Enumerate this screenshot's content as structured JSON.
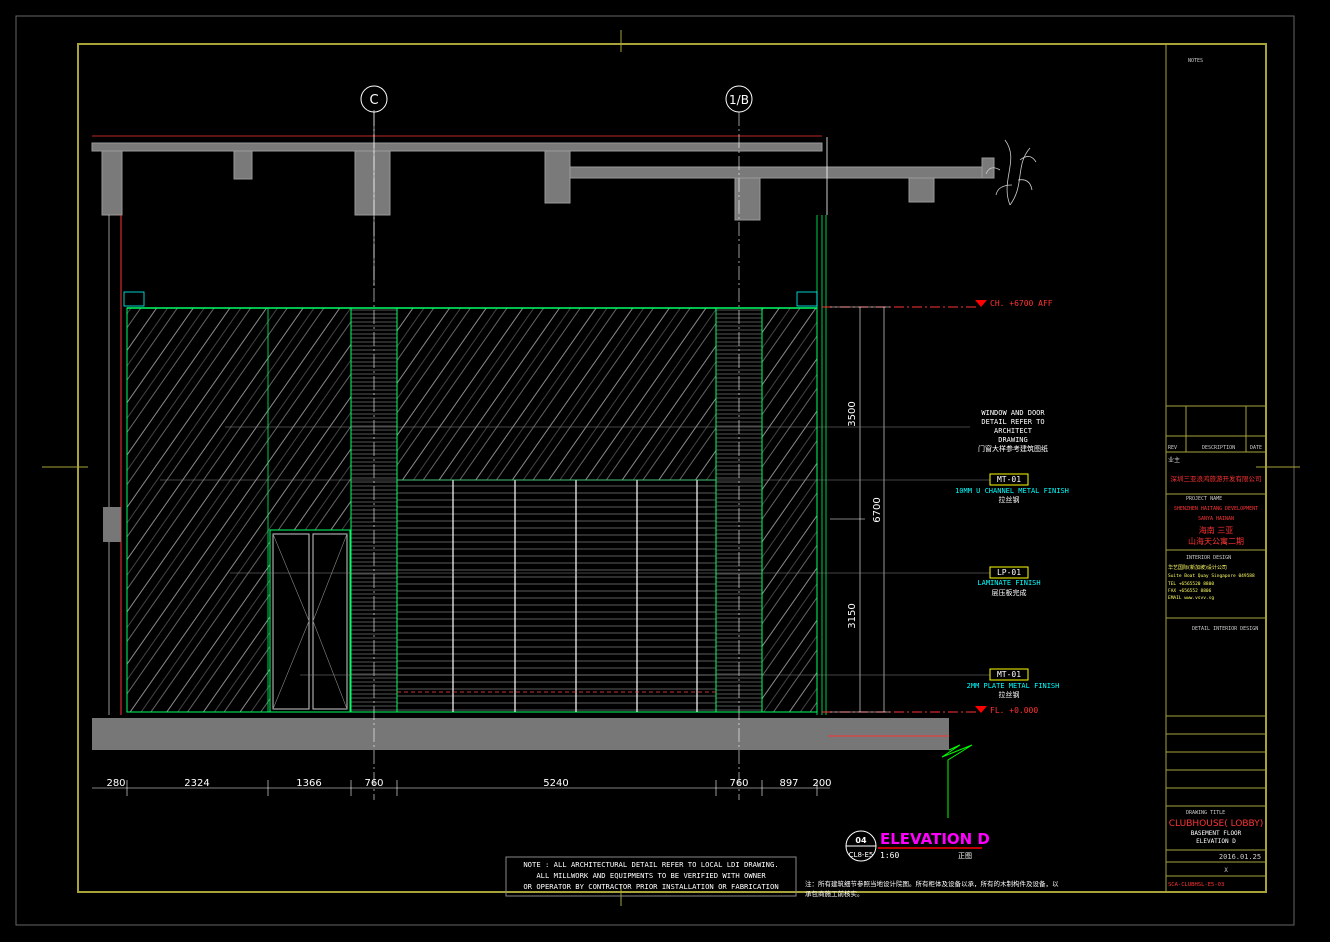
{
  "grid": {
    "left_label": "C",
    "right_label": "1/B"
  },
  "levels": {
    "ceiling": "CH. +6700 AFF",
    "floor": "FL. +0.000"
  },
  "vertical_dims": {
    "upper": "3500",
    "lower": "3150",
    "total": "6700"
  },
  "horizontal_dims": [
    "280",
    "2324",
    "1366",
    "760",
    "5240",
    "760",
    "897",
    "200"
  ],
  "callouts": {
    "window_note": [
      "WINDOW AND DOOR",
      "DETAIL REFER TO",
      "ARCHITECT",
      "DRAWING",
      "门窗大样参考建筑图纸"
    ],
    "mt1_tag": "MT-01",
    "mt1_desc": "10MM U CHANNEL METAL FINISH",
    "mt1_cn": "拉丝钢",
    "lp1_tag": "LP-01",
    "lp1_desc": "LAMINATE FINISH",
    "lp1_cn": "层压板完成",
    "mt1b_tag": "MT-01",
    "mt1b_desc": "2MM PLATE METAL FINISH",
    "mt1b_cn": "拉丝钢"
  },
  "title_mark": {
    "number": "04",
    "sheet": "CL8-E5",
    "title": "ELEVATION D",
    "scale": "1:60",
    "scale_note": "正图"
  },
  "notes": {
    "en": [
      "NOTE : ALL ARCHITECTURAL DETAIL REFER TO LOCAL LDI DRAWING.",
      "ALL MILLWORK AND EQUIPMENTS TO BE VERIFIED WITH OWNER",
      "OR OPERATOR BY CONTRACTOR PRIOR INSTALLATION OR FABRICATION"
    ],
    "cn": [
      "注：所有建筑细节参照当地设计院图。所有柜体及设备以承，所有的木制构件及设备，以",
      "承包商施工前核实。"
    ]
  },
  "title_block": {
    "notes_header": "NOTES",
    "rev_header": [
      "REV",
      "DESCRIPTION",
      "DATE"
    ],
    "owner_label": "业主",
    "owner_name": "深圳三亚浪鸿旅游开发有限公司",
    "project_label": "PROJECT NAME",
    "project_en": "SHENZHEN HAITANG DEVELOPMENT",
    "project_en2": "SANYA HAINAN",
    "project_cn": "海南 三亚",
    "project_cn2": "山海天公寓二期",
    "designer_label": "INTERIOR DESIGN",
    "designer_name": "华艺国际(新加坡)设计公司",
    "designer_addr": "Suite Boat Quay Singapore 049588",
    "tel": "TEL  +6565520 8800",
    "fax": "FAX  +656552 8806",
    "email": "EMAIL  www.vsvv.sg",
    "stage_label": "DETAIL INTERIOR DESIGN",
    "drawing_title_label": "DRAWING TITLE",
    "drawing_title": "CLUBHOUSE( LOBBY)",
    "drawing_sub1": "BASEMENT FLOOR",
    "drawing_sub2": "ELEVATION D",
    "date": "2016.01.25",
    "job_no": "X",
    "drawing_no": "SCA-CLUBHSL-E5-03"
  },
  "colors": {
    "frame": "#a7a338",
    "cyan": "#00ffff",
    "red": "#ff0000",
    "magenta": "#ff00ff",
    "line": "#ffffff",
    "green": "#00ff00"
  }
}
